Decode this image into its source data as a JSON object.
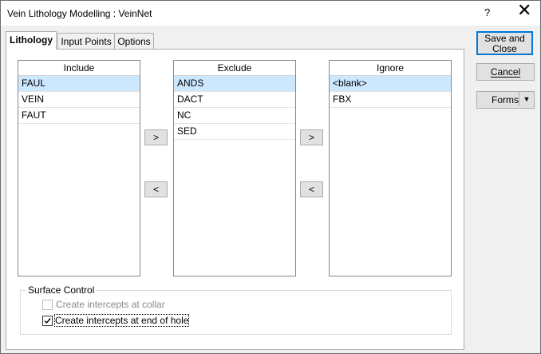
{
  "window": {
    "title": "Vein Lithology Modelling : VeinNet",
    "help_label": "?",
    "close_label": "✕"
  },
  "tabs": [
    {
      "label": "Lithology",
      "active": true
    },
    {
      "label": "Input Points",
      "active": false
    },
    {
      "label": "Options",
      "active": false
    }
  ],
  "lists": {
    "include": {
      "header": "Include",
      "items": [
        "FAUL",
        "VEIN",
        "FAUT"
      ],
      "selected": "FAUL"
    },
    "exclude": {
      "header": "Exclude",
      "items": [
        "ANDS",
        "DACT",
        "NC",
        "SED"
      ],
      "selected": "ANDS"
    },
    "ignore": {
      "header": "Ignore",
      "items": [
        "<blank>",
        "FBX"
      ],
      "selected": "<blank>"
    }
  },
  "move_buttons": {
    "right_1": ">",
    "left_1": "<",
    "right_2": ">",
    "left_2": "<"
  },
  "surface_control": {
    "label": "Surface Control",
    "collar": {
      "label": "Create intercepts at collar",
      "checked": false,
      "enabled": false
    },
    "end_of_hole": {
      "label": "Create intercepts at end of hole",
      "checked": true,
      "enabled": true
    }
  },
  "side_buttons": {
    "save_close": "Save and Close",
    "cancel": "Cancel",
    "forms": "Forms"
  }
}
